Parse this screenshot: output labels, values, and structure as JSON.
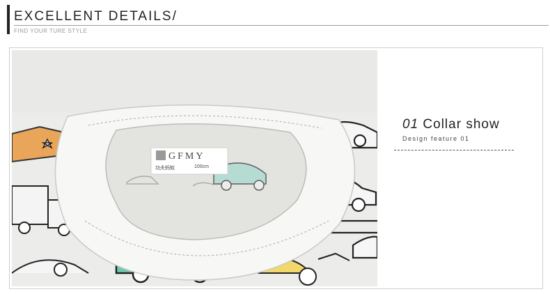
{
  "header": {
    "title": "EXCELLENT DETAILS/",
    "subtitle": "FIND YOUR TURE STYLE"
  },
  "photo": {
    "label_brand": "GFMY",
    "label_chinese": "功夫蚂蚁",
    "label_size": "100cm"
  },
  "feature": {
    "number": "01",
    "title": "Collar show",
    "subtitle": "Design feature 01"
  },
  "colors": {
    "accent_teal": "#6fc9b0",
    "accent_orange": "#e9a65a",
    "fabric": "#ebebe9",
    "text": "#222222"
  }
}
